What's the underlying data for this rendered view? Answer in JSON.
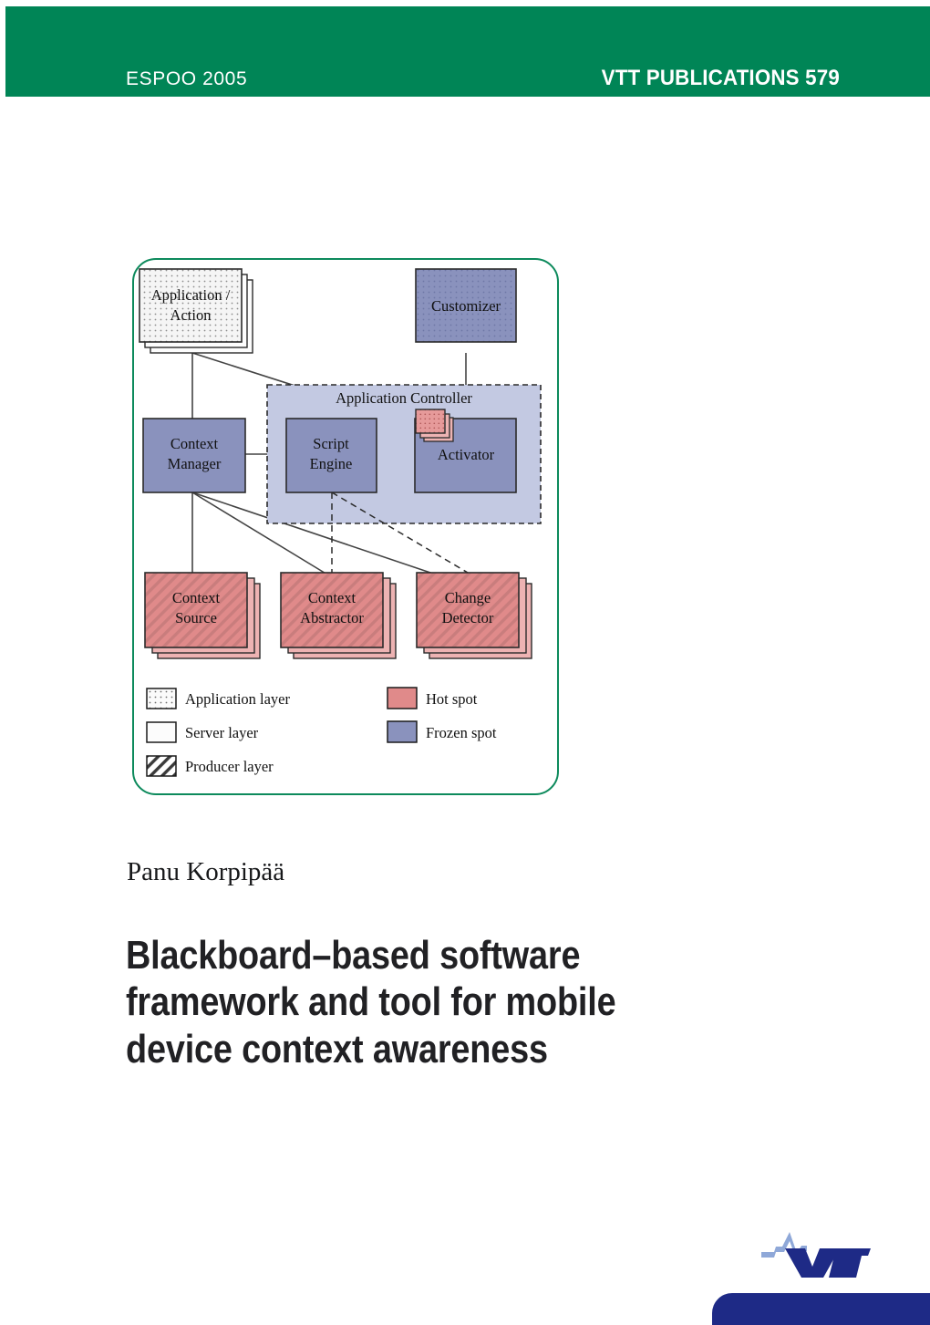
{
  "header": {
    "place_year": "ESPOO 2005",
    "publication": "VTT PUBLICATIONS 579",
    "band_color": "#008556"
  },
  "author": "Panu Korpipää",
  "title": {
    "line1": "Blackboard–based software",
    "line2": "framework and tool for mobile",
    "line3": "device context awareness"
  },
  "figure": {
    "frame_color": "#0d8a5c",
    "boxes": {
      "application_action": "Application /\nAction",
      "application_action_l1": "Application /",
      "application_action_l2": "Action",
      "customizer": "Customizer",
      "application_controller": "Application Controller",
      "context_manager_l1": "Context",
      "context_manager_l2": "Manager",
      "script_engine_l1": "Script",
      "script_engine_l2": "Engine",
      "activator": "Activator",
      "context_source_l1": "Context",
      "context_source_l2": "Source",
      "context_abstractor_l1": "Context",
      "context_abstractor_l2": "Abstractor",
      "change_detector_l1": "Change",
      "change_detector_l2": "Detector"
    },
    "legend": {
      "application_layer": "Application layer",
      "server_layer": "Server layer",
      "producer_layer": "Producer layer",
      "hot_spot": "Hot spot",
      "frozen_spot": "Frozen spot"
    },
    "colors": {
      "hot_spot": "#e08a8a",
      "frozen_spot": "#8a92bd",
      "controller_fill": "#c3c9e2",
      "application_layer": "#f4f4f4",
      "server_layer": "#fcfcfc",
      "hatch": "#b07a7a",
      "outline": "#2b2b2b"
    }
  },
  "logo": {
    "wordmark": "VTT",
    "accent_color": "#8fa8d8",
    "mark_color": "#1e2a86",
    "bar_color": "#1e2a86"
  }
}
